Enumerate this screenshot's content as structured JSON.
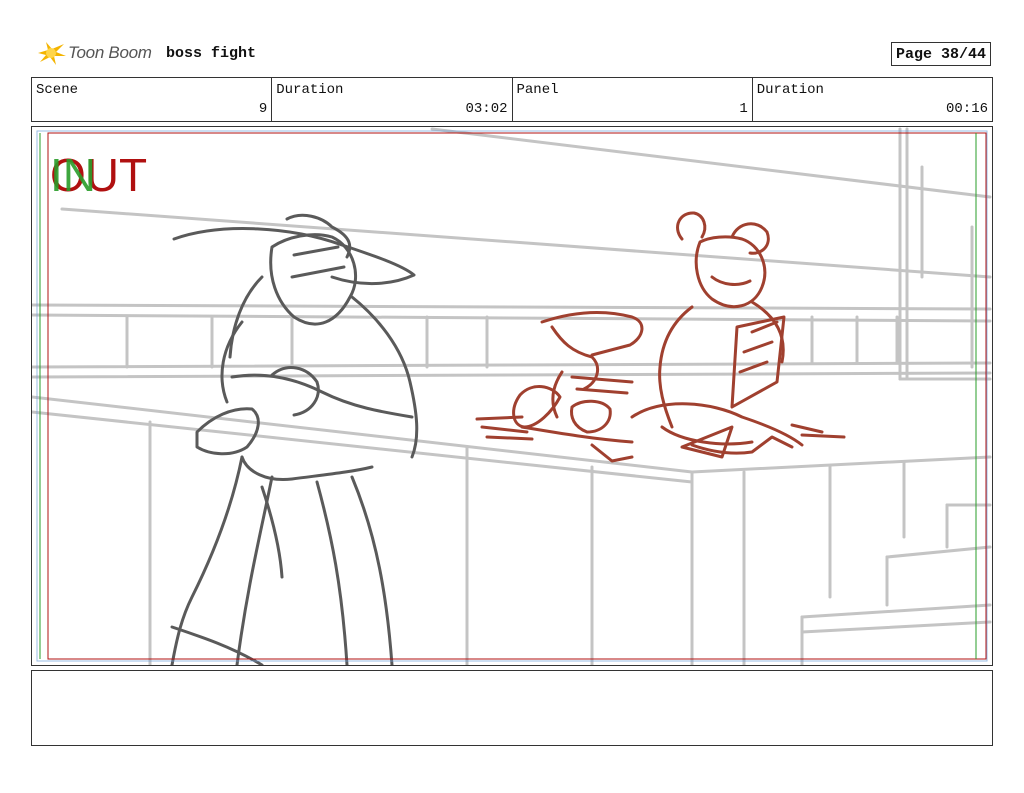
{
  "header": {
    "logo_text": "Toon Boom",
    "project_title": "boss fight",
    "page": "Page 38/44"
  },
  "info": {
    "scene_label": "Scene",
    "scene_value": "9",
    "scene_duration_label": "Duration",
    "scene_duration_value": "03:02",
    "panel_label": "Panel",
    "panel_value": "1",
    "panel_duration_label": "Duration",
    "panel_duration_value": "00:16"
  },
  "panel": {
    "in_label": "IN",
    "out_label": "OUT",
    "in_color": "#2a9d2a",
    "out_color": "#b01010",
    "sketch_color_main": "#5a5a5a",
    "sketch_color_bg": "#bdbdbd",
    "sketch_color_red": "#a0402f"
  },
  "notes": {
    "text": ""
  }
}
